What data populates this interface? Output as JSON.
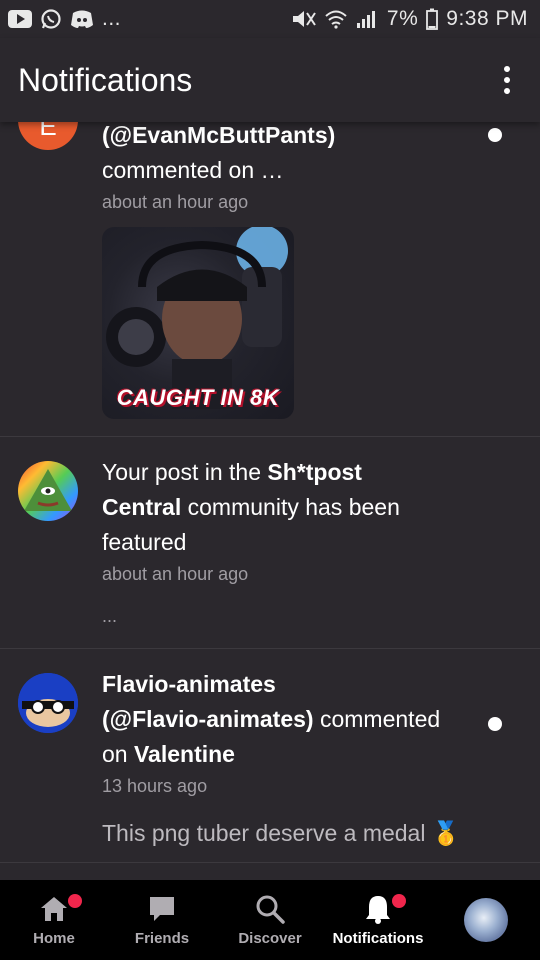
{
  "status_bar": {
    "battery": "7%",
    "time": "9:38 PM",
    "ellipsis": "..."
  },
  "header": {
    "title": "Notifications"
  },
  "notifications": [
    {
      "avatar_letter": "E",
      "actor": "(@EvanMcButtPants)",
      "action": "commented on …",
      "time": "about an hour ago",
      "thumbnail_caption": "CAUGHT IN 8K",
      "unread": true
    },
    {
      "text_pre": "Your post in the ",
      "community": "Sh*tpost Central",
      "text_post": " community has been featured",
      "time": "about an hour ago",
      "more": "...",
      "unread": false
    },
    {
      "actor": "Flavio-animates",
      "handle": "(@Flavio-animates)",
      "action_mid": " commented ",
      "action_on": "on ",
      "target": "Valentine",
      "time": "13 hours ago",
      "comment": "This png tuber deserve a medal 🥇",
      "unread": true
    }
  ],
  "bottom_nav": {
    "items": [
      {
        "label": "Home",
        "icon": "home-icon",
        "badge": true
      },
      {
        "label": "Friends",
        "icon": "chat-icon",
        "badge": false
      },
      {
        "label": "Discover",
        "icon": "search-icon",
        "badge": false
      },
      {
        "label": "Notifications",
        "icon": "bell-icon",
        "badge": true,
        "active": true
      }
    ]
  },
  "colors": {
    "background": "#2b282d",
    "nav_background": "#000000",
    "badge": "#f0264c",
    "secondary_text": "#a09da3"
  }
}
